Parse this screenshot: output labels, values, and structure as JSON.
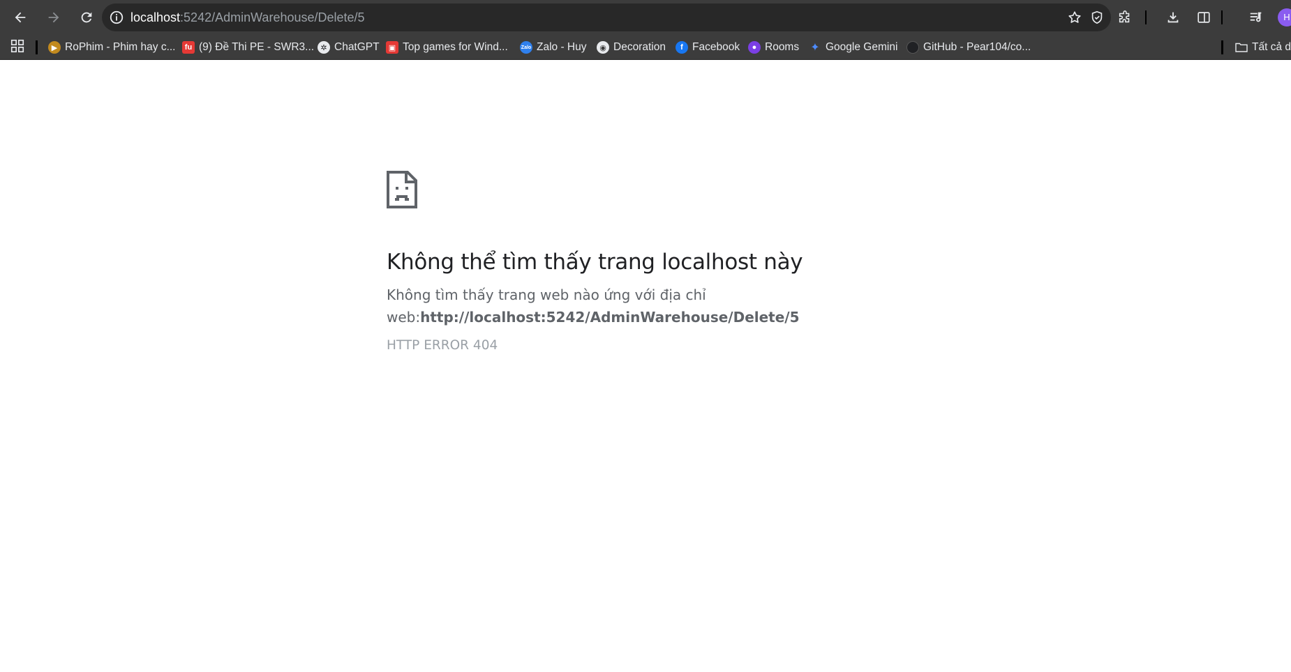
{
  "browser": {
    "address_bar": {
      "host": "localhost",
      "path": ":5242/AdminWarehouse/Delete/5"
    },
    "profile_initial": "H",
    "bookmarks": [
      {
        "label": "RoPhim - Phim hay c...",
        "icon": "rophim-favicon",
        "color": "#f0b429"
      },
      {
        "label": "(9) Đề Thi PE - SWR3...",
        "icon": "fu-favicon",
        "color": "#e53935"
      },
      {
        "label": "ChatGPT",
        "icon": "chatgpt-favicon",
        "color": "#202124"
      },
      {
        "label": "Top games for Wind...",
        "icon": "games-favicon",
        "color": "#e53935"
      },
      {
        "label": "Zalo - Huy",
        "icon": "zalo-favicon",
        "color": "#2f80ed"
      },
      {
        "label": "Decoration",
        "icon": "globe-favicon",
        "color": "#e8eaed"
      },
      {
        "label": "Facebook",
        "icon": "facebook-favicon",
        "color": "#1877f2"
      },
      {
        "label": "Rooms",
        "icon": "rooms-favicon",
        "color": "#7b3fe4"
      },
      {
        "label": "Google Gemini",
        "icon": "gemini-favicon",
        "color": "#4e8cff"
      },
      {
        "label": "GitHub - Pear104/co...",
        "icon": "github-favicon",
        "color": "#202124"
      }
    ],
    "all_bookmarks_label": "Tất cả dấ"
  },
  "error_page": {
    "title": "Không thể tìm thấy trang localhost này",
    "description_prefix": "Không tìm thấy trang web nào ứng với địa chỉ web:",
    "url": "http://localhost:5242/AdminWarehouse/Delete/5",
    "code": "HTTP ERROR 404"
  }
}
